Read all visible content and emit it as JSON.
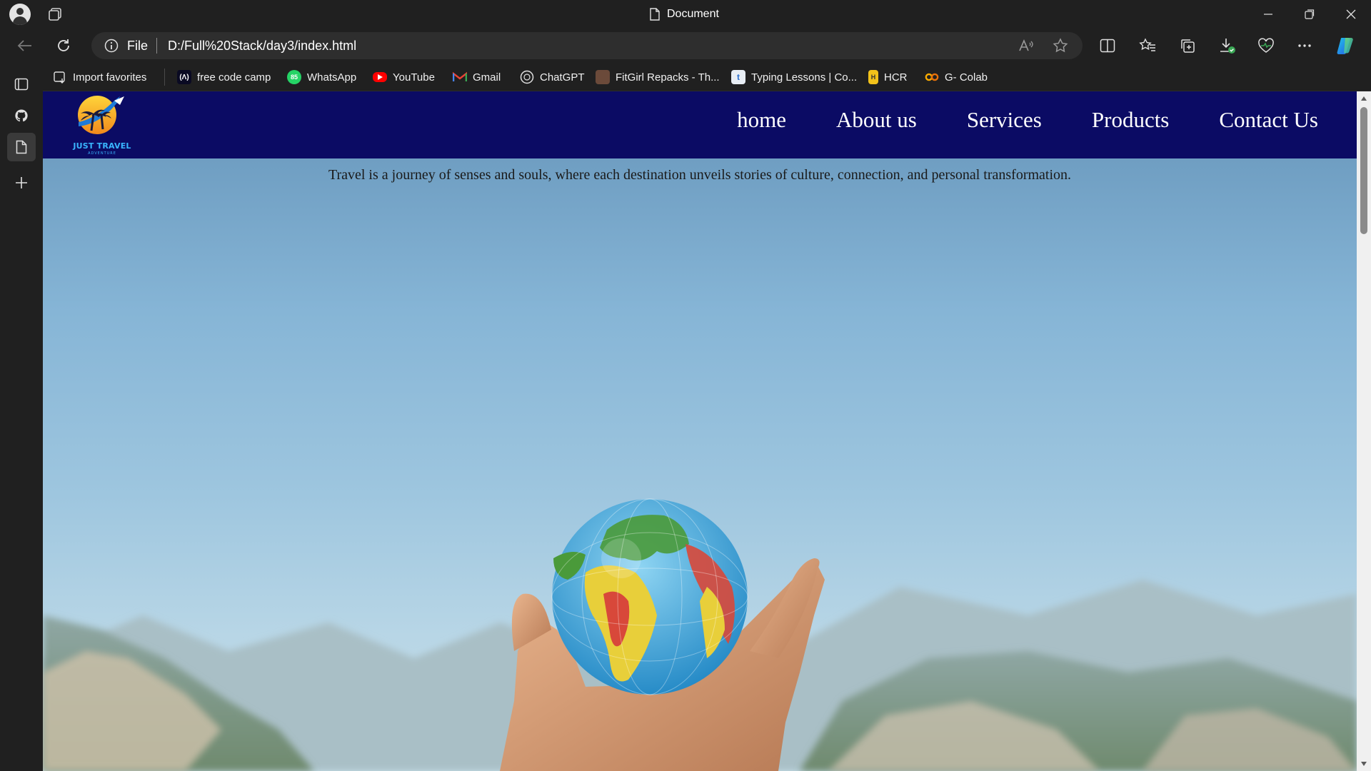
{
  "window": {
    "title": "Document",
    "controls": [
      "minimize",
      "restore",
      "close"
    ]
  },
  "address_bar": {
    "scheme_label": "File",
    "url": "D:/Full%20Stack/day3/index.html"
  },
  "favorites": [
    {
      "label": "Import favorites",
      "icon": "import-icon"
    },
    {
      "label": "free code camp",
      "icon": "freecodecamp-icon"
    },
    {
      "label": "WhatsApp",
      "icon": "whatsapp-icon"
    },
    {
      "label": "YouTube",
      "icon": "youtube-icon"
    },
    {
      "label": "Gmail",
      "icon": "gmail-icon"
    },
    {
      "label": "ChatGPT",
      "icon": "chatgpt-icon"
    },
    {
      "label": "FitGirl Repacks - Th...",
      "icon": "fitgirl-icon"
    },
    {
      "label": "Typing Lessons | Co...",
      "icon": "typing-icon"
    },
    {
      "label": "HCR",
      "icon": "hcr-icon"
    },
    {
      "label": "G- Colab",
      "icon": "colab-icon"
    }
  ],
  "sidebar": [
    "tabs-icon",
    "github-icon",
    "document-icon",
    "add-icon"
  ],
  "site": {
    "logo_text": "JUST TRAVEL",
    "logo_subtext": "ADVENTURE",
    "nav": [
      "home",
      "About us",
      "Services",
      "Products",
      "Contact Us"
    ],
    "tagline": "Travel is a journey of senses and souls, where each destination unveils stories of culture, connection, and personal transformation.",
    "nav_bg": "#0b0b64"
  }
}
